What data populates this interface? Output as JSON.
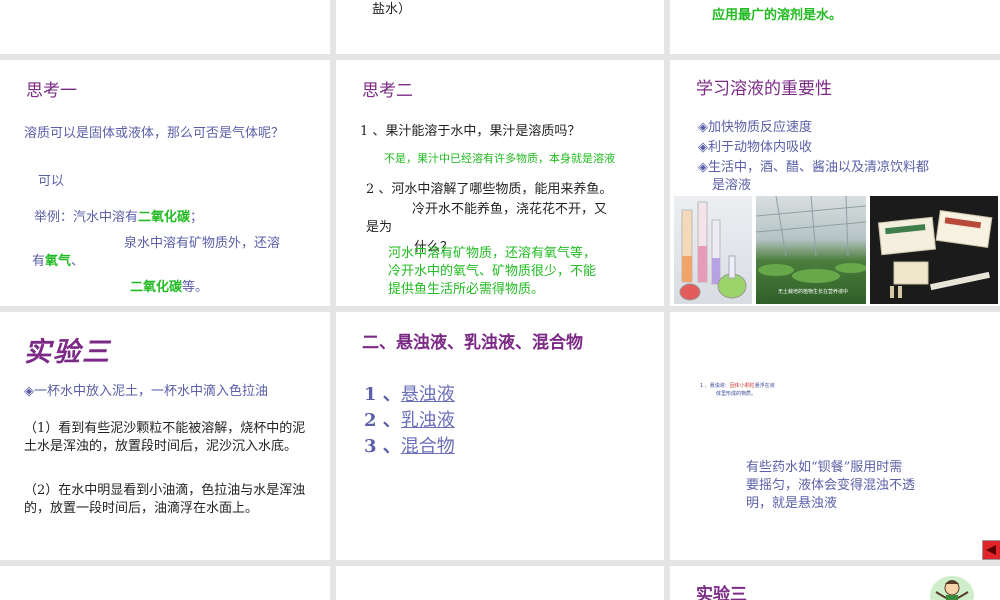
{
  "slides": {
    "s1": {
      "text": "盐水）"
    },
    "s3": {
      "text": "应用最广的溶剂是水。"
    },
    "s4": {
      "title": "思考一",
      "q": "溶质可以是固体或液体，那么可否是气体呢？",
      "a1": "可以",
      "a2_pre": "举例：汽水中溶有",
      "a2_hl": "二氧化碳",
      "a2_post": "；",
      "a3_pre": "泉水中溶有矿物质外，还溶",
      "a3_mid": "有",
      "a3_hl": "氧气",
      "a3_post": "、",
      "a4_hl": "二氧化碳",
      "a4_post": "等。"
    },
    "s5": {
      "title": "思考二",
      "q1": "1 、果汁能溶于水中，果汁是溶质吗？",
      "a1": "不是，果汁中已经溶有许多物质，本身就是溶液",
      "q2a": "2 、河水中溶解了哪些物质，能用来养鱼。",
      "q2b": "冷开水不能养鱼，浇花花不开，又",
      "q2c": "是为",
      "q2d": "什么？",
      "a2a": "河水中溶有矿物质，还溶有氧气等，",
      "a2b": "冷开水中的氧气、矿物质很少，不能",
      "a2c": "提供鱼生活所必需得物质。"
    },
    "s6": {
      "title": "学习溶液的重要性",
      "items": [
        "加快物质反应速度",
        "利于动物体内吸收",
        "生活中，酒、醋、酱油以及清凉饮料都",
        "是溶液"
      ],
      "caption": "无土栽培的植物生长在营养液中"
    },
    "s7": {
      "title": "实验三",
      "intro": "一杯水中放入泥土，一杯水中滴入色拉油",
      "p1": "（1）看到有些泥沙颗粒不能被溶解，烧杯中的泥土水是浑浊的，放置段时间后，泥沙沉入水底。",
      "p2": "（2）在水中明显看到小油滴，色拉油与水是浑浊的，放置一段时间后，油滴浮在水面上。"
    },
    "s8": {
      "title": "二、悬浊液、乳浊液、混合物",
      "links": [
        {
          "num": "1 、",
          "label": "悬浊液"
        },
        {
          "num": "2 、",
          "label": "乳浊液"
        },
        {
          "num": "3 、",
          "label": "混合物"
        }
      ]
    },
    "s9": {
      "tiny_pre": "1 、悬浊液：",
      "tiny_red": "固体小颗粒",
      "tiny_post": "悬浮在液",
      "tiny2": "体里形成的物质。",
      "text1": "有些药水如“钡餐”服用时需",
      "text2": "要摇匀，液体会变得混浊不透",
      "text3": "明，就是悬浊液"
    },
    "s12": {
      "title": "实验三"
    }
  },
  "colors": {
    "title_purple": "#7b2a86",
    "body_blue": "#5a5fa8",
    "answer_green": "#22bb22",
    "nav_red": "#e0242a"
  },
  "icons": [
    "bullet-diamond-icon",
    "back-arrow-icon",
    "cartoon-scientist-icon"
  ]
}
